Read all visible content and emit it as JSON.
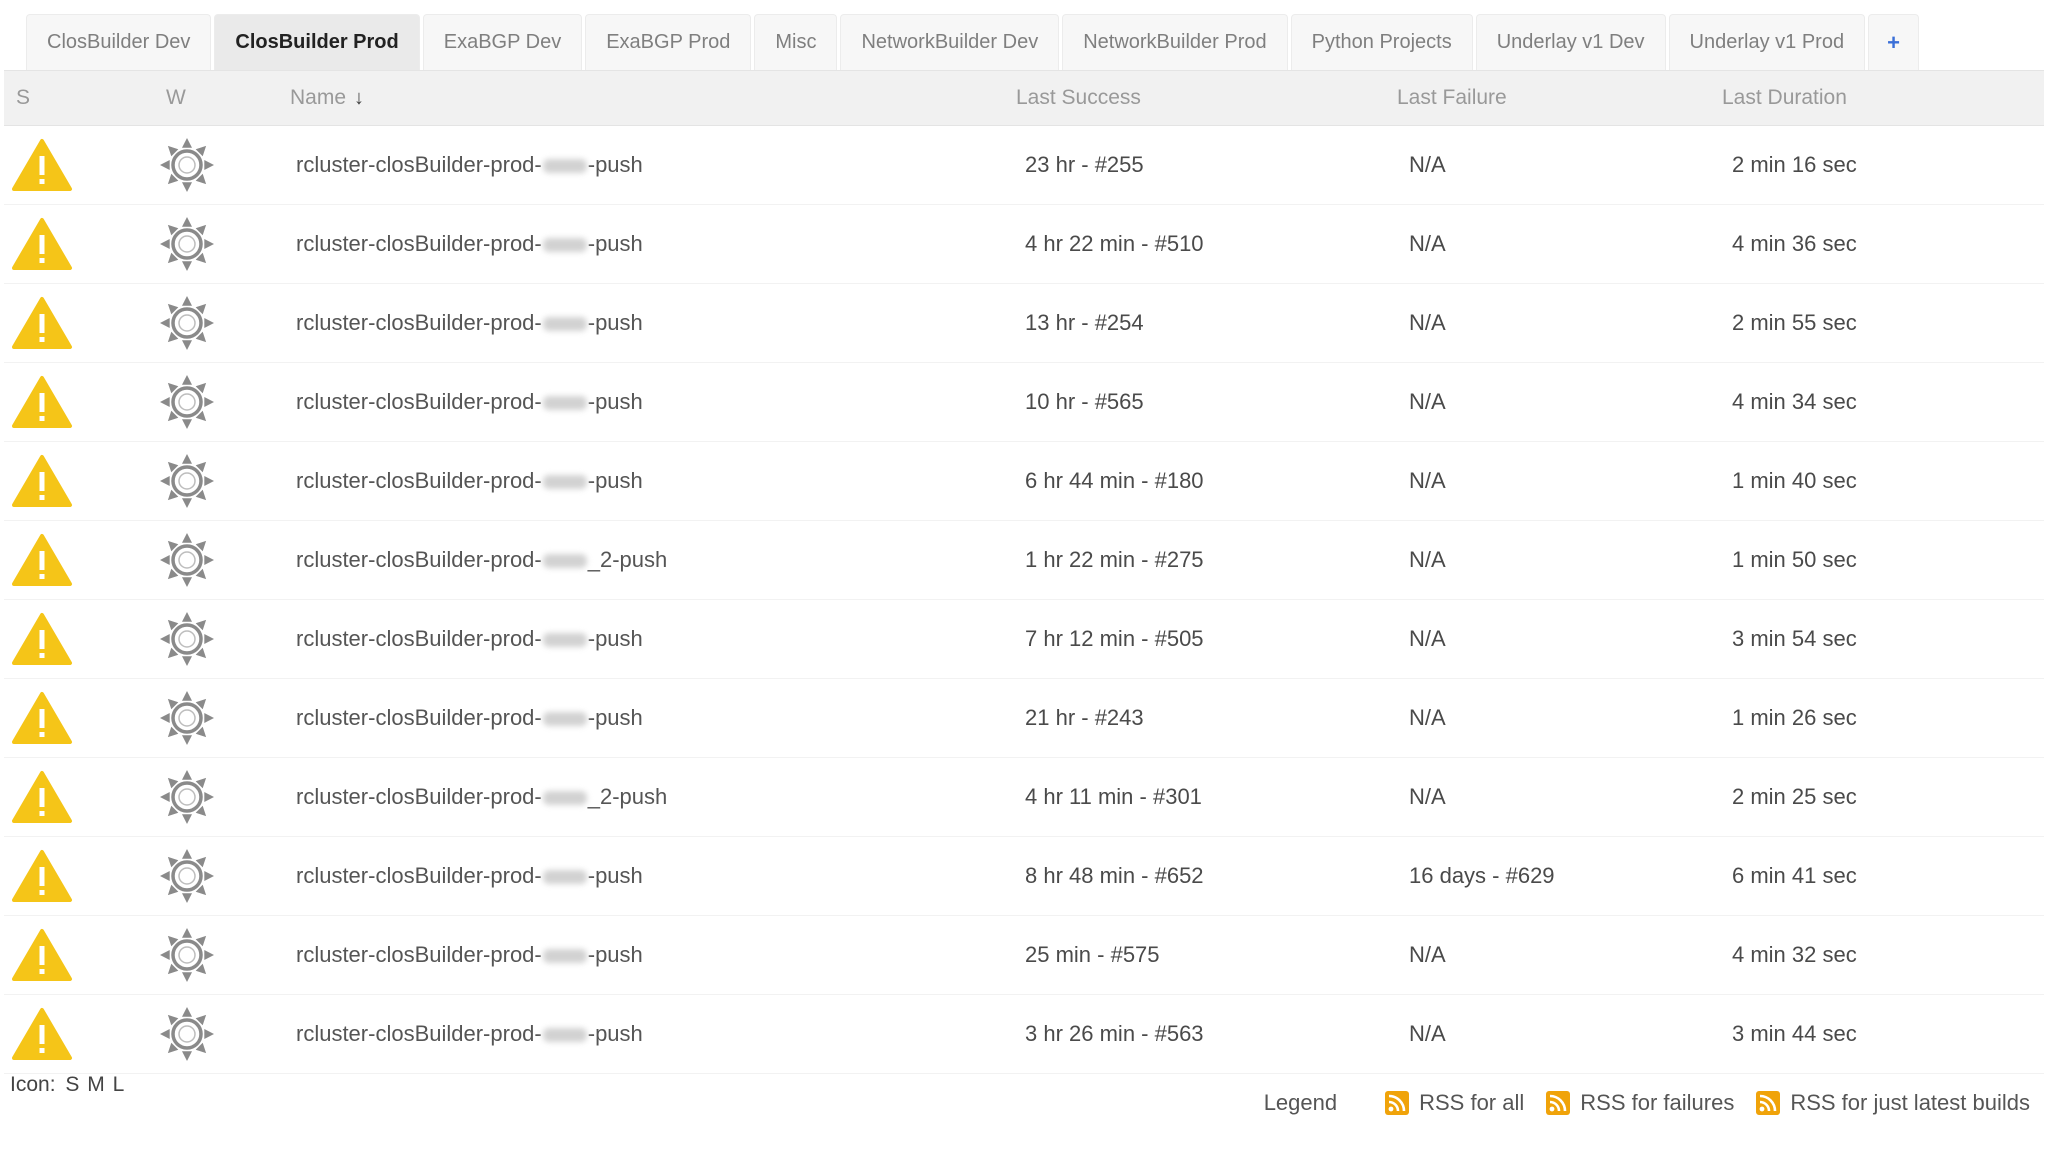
{
  "tabs": [
    {
      "label": "ClosBuilder Dev",
      "active": false
    },
    {
      "label": "ClosBuilder Prod",
      "active": true
    },
    {
      "label": "ExaBGP Dev",
      "active": false
    },
    {
      "label": "ExaBGP Prod",
      "active": false
    },
    {
      "label": "Misc",
      "active": false
    },
    {
      "label": "NetworkBuilder Dev",
      "active": false
    },
    {
      "label": "NetworkBuilder Prod",
      "active": false
    },
    {
      "label": "Python Projects",
      "active": false
    },
    {
      "label": "Underlay v1 Dev",
      "active": false
    },
    {
      "label": "Underlay v1 Prod",
      "active": false
    }
  ],
  "add_tab_label": "+",
  "columns": {
    "status": "S",
    "weather": "W",
    "name": "Name",
    "sort_arrow": "↓",
    "last_success": "Last Success",
    "last_failure": "Last Failure",
    "last_duration": "Last Duration"
  },
  "jobs": [
    {
      "name_prefix": "rcluster-closBuilder-prod-",
      "name_suffix": "-push",
      "last_success": "23 hr - #255",
      "last_failure": "N/A",
      "last_duration": "2 min 16 sec",
      "status": "unstable",
      "weather": "sunny"
    },
    {
      "name_prefix": "rcluster-closBuilder-prod-",
      "name_suffix": "-push",
      "last_success": "4 hr 22 min - #510",
      "last_failure": "N/A",
      "last_duration": "4 min 36 sec",
      "status": "unstable",
      "weather": "sunny"
    },
    {
      "name_prefix": "rcluster-closBuilder-prod-",
      "name_suffix": "-push",
      "last_success": "13 hr - #254",
      "last_failure": "N/A",
      "last_duration": "2 min 55 sec",
      "status": "unstable",
      "weather": "sunny"
    },
    {
      "name_prefix": "rcluster-closBuilder-prod-",
      "name_suffix": "-push",
      "last_success": "10 hr - #565",
      "last_failure": "N/A",
      "last_duration": "4 min 34 sec",
      "status": "unstable",
      "weather": "sunny"
    },
    {
      "name_prefix": "rcluster-closBuilder-prod-",
      "name_suffix": "-push",
      "last_success": "6 hr 44 min - #180",
      "last_failure": "N/A",
      "last_duration": "1 min 40 sec",
      "status": "unstable",
      "weather": "sunny"
    },
    {
      "name_prefix": "rcluster-closBuilder-prod-",
      "name_suffix": "_2-push",
      "last_success": "1 hr 22 min - #275",
      "last_failure": "N/A",
      "last_duration": "1 min 50 sec",
      "status": "unstable",
      "weather": "sunny"
    },
    {
      "name_prefix": "rcluster-closBuilder-prod-",
      "name_suffix": "-push",
      "last_success": "7 hr 12 min - #505",
      "last_failure": "N/A",
      "last_duration": "3 min 54 sec",
      "status": "unstable",
      "weather": "sunny"
    },
    {
      "name_prefix": "rcluster-closBuilder-prod-",
      "name_suffix": "-push",
      "last_success": "21 hr - #243",
      "last_failure": "N/A",
      "last_duration": "1 min 26 sec",
      "status": "unstable",
      "weather": "sunny"
    },
    {
      "name_prefix": "rcluster-closBuilder-prod-",
      "name_suffix": "_2-push",
      "last_success": "4 hr 11 min - #301",
      "last_failure": "N/A",
      "last_duration": "2 min 25 sec",
      "status": "unstable",
      "weather": "sunny"
    },
    {
      "name_prefix": "rcluster-closBuilder-prod-",
      "name_suffix": "-push",
      "last_success": "8 hr 48 min - #652",
      "last_failure": "16 days - #629",
      "last_duration": "6 min 41 sec",
      "status": "unstable",
      "weather": "sunny"
    },
    {
      "name_prefix": "rcluster-closBuilder-prod-",
      "name_suffix": "-push",
      "last_success": "25 min - #575",
      "last_failure": "N/A",
      "last_duration": "4 min 32 sec",
      "status": "unstable",
      "weather": "sunny"
    },
    {
      "name_prefix": "rcluster-closBuilder-prod-",
      "name_suffix": "-push",
      "last_success": "3 hr 26 min - #563",
      "last_failure": "N/A",
      "last_duration": "3 min 44 sec",
      "status": "unstable",
      "weather": "sunny"
    }
  ],
  "footer": {
    "icon_label": "Icon:",
    "sizes": [
      "S",
      "M",
      "L"
    ],
    "legend_label": "Legend",
    "rss_links": [
      "RSS for all",
      "RSS for failures",
      "RSS for just latest builds"
    ]
  },
  "colors": {
    "warning": "#f5c518",
    "rss": "#f0a30a",
    "add_tab": "#3a6fd8"
  },
  "icons": {
    "status": "warning-triangle-icon",
    "weather": "sun-icon",
    "rss": "rss-feed-icon"
  }
}
